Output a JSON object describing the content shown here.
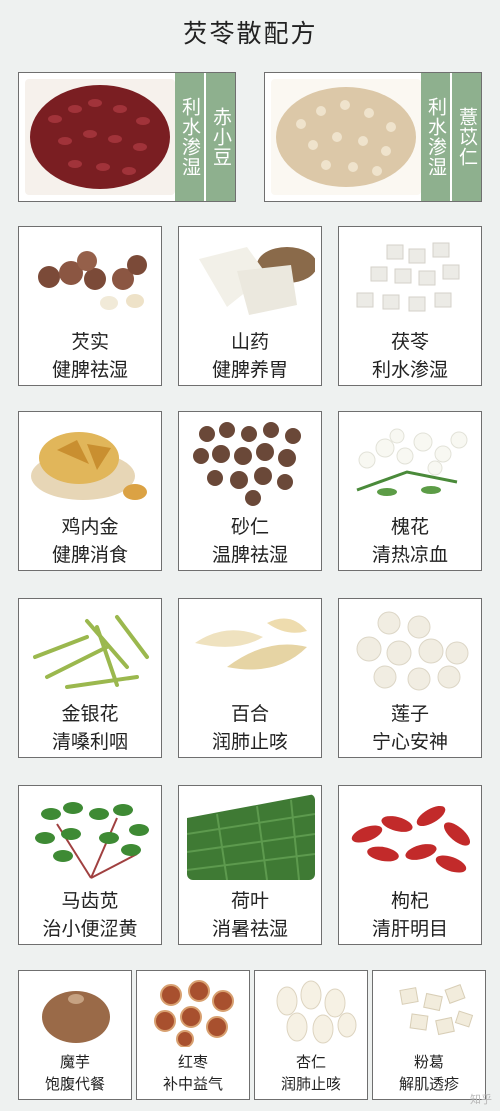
{
  "title": "芡苓散配方",
  "top": [
    {
      "name": "赤小豆",
      "effect": "利水渗湿"
    },
    {
      "name": "薏苡仁",
      "effect": "利水渗湿"
    }
  ],
  "grid": [
    {
      "name": "芡实",
      "effect": "健脾祛湿"
    },
    {
      "name": "山药",
      "effect": "健脾养胃"
    },
    {
      "name": "茯苓",
      "effect": "利水渗湿"
    },
    {
      "name": "鸡内金",
      "effect": "健脾消食"
    },
    {
      "name": "砂仁",
      "effect": "温脾祛湿"
    },
    {
      "name": "槐花",
      "effect": "清热凉血"
    },
    {
      "name": "金银花",
      "effect": "清嗓利咽"
    },
    {
      "name": "百合",
      "effect": "润肺止咳"
    },
    {
      "name": "莲子",
      "effect": "宁心安神"
    },
    {
      "name": "马齿苋",
      "effect": "治小便涩黄"
    },
    {
      "name": "荷叶",
      "effect": "消暑祛湿"
    },
    {
      "name": "枸杞",
      "effect": "清肝明目"
    }
  ],
  "bottom": [
    {
      "name": "魔芋",
      "effect": "饱腹代餐"
    },
    {
      "name": "红枣",
      "effect": "补中益气"
    },
    {
      "name": "杏仁",
      "effect": "润肺止咳"
    },
    {
      "name": "粉葛",
      "effect": "解肌透疹"
    }
  ],
  "watermark": "知乎"
}
